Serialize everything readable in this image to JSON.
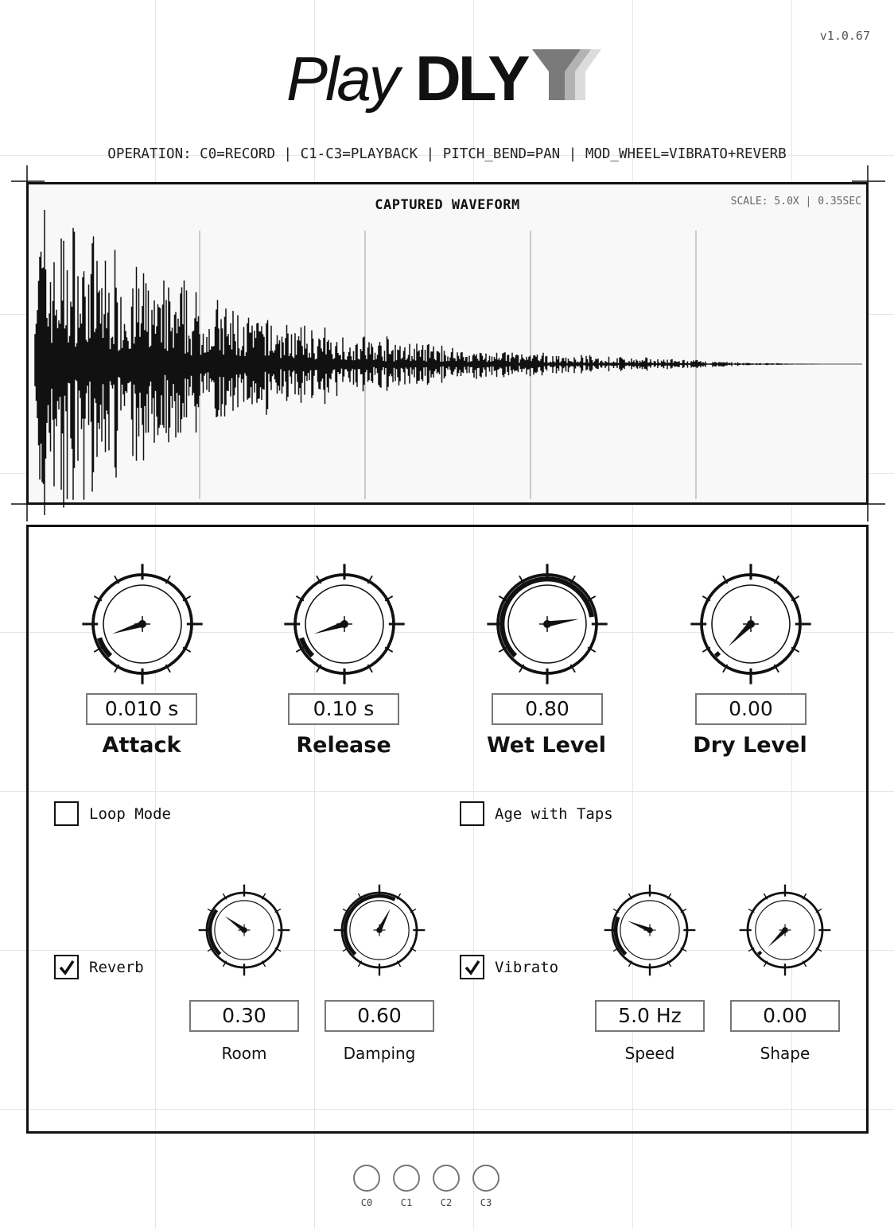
{
  "app": {
    "version": "v1.0.67"
  },
  "logo": {
    "text_light": "Play",
    "text_bold": "DLY"
  },
  "operation": "OPERATION: C0=RECORD | C1-C3=PLAYBACK | PITCH_BEND=PAN | MOD_WHEEL=VIBRATO+REVERB",
  "waveform": {
    "title": "CAPTURED WAVEFORM",
    "scale": "SCALE: 5.0X | 0.35SEC"
  },
  "knobs": [
    {
      "id": "attack",
      "label": "Attack",
      "value_text": "0.010 s",
      "position": 0.1
    },
    {
      "id": "release",
      "label": "Release",
      "value_text": "0.10 s",
      "position": 0.1
    },
    {
      "id": "wet",
      "label": "Wet Level",
      "value_text": "0.80",
      "position": 0.8
    },
    {
      "id": "dry",
      "label": "Dry Level",
      "value_text": "0.00",
      "position": 0.0
    }
  ],
  "checkboxes": [
    {
      "id": "loop",
      "label": "Loop Mode",
      "checked": false
    },
    {
      "id": "age",
      "label": "Age with Taps",
      "checked": false
    },
    {
      "id": "reverb",
      "label": "Reverb",
      "checked": true
    },
    {
      "id": "vibrato",
      "label": "Vibrato",
      "checked": true
    }
  ],
  "small_knobs": [
    {
      "id": "room",
      "label": "Room",
      "value_text": "0.30",
      "position": 0.3
    },
    {
      "id": "damping",
      "label": "Damping",
      "value_text": "0.60",
      "position": 0.6
    },
    {
      "id": "speed",
      "label": "Speed",
      "value_text": "5.0 Hz",
      "position": 0.25
    },
    {
      "id": "shape",
      "label": "Shape",
      "value_text": "0.00",
      "position": 0.0
    }
  ],
  "pads": [
    "C0",
    "C1",
    "C2",
    "C3"
  ],
  "colors": {
    "ink": "#111111",
    "grid": "#e6e6e6",
    "panel": "#f8f8f8",
    "box_border": "#777777"
  }
}
